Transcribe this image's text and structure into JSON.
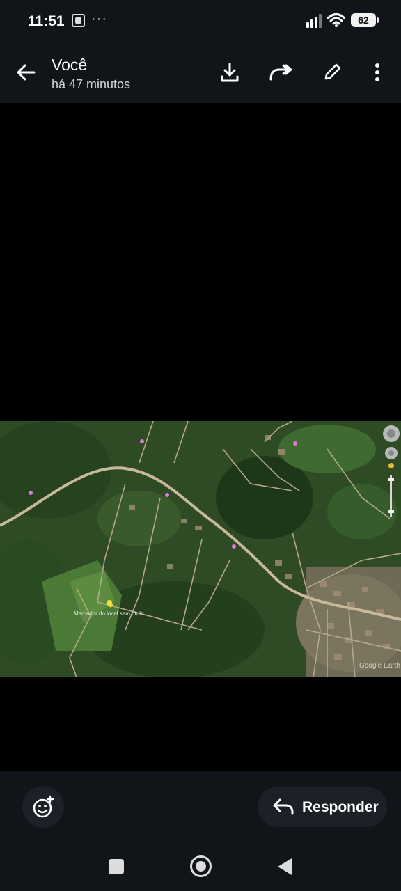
{
  "status_bar": {
    "time": "11:51",
    "more": "···",
    "battery": "62"
  },
  "header": {
    "title": "Você",
    "subtitle": "há 47 minutos",
    "icons": [
      "arrow-back-icon",
      "download-icon",
      "forward-icon",
      "edit-icon",
      "more-vert-icon"
    ]
  },
  "image": {
    "description_hidden": "",
    "labels": {
      "marker": "Marcador do local sem título",
      "brand": "Google Earth"
    }
  },
  "bottom_bar": {
    "reply_label": "Responder",
    "icons": [
      "emoji-add-icon",
      "reply-icon"
    ]
  },
  "nav_bar": {
    "icons": [
      "recent-apps-icon",
      "home-icon",
      "back-icon"
    ]
  },
  "colors": {
    "bar_bg": "#111418",
    "pill_bg": "#1c2127",
    "background": "#000000"
  }
}
